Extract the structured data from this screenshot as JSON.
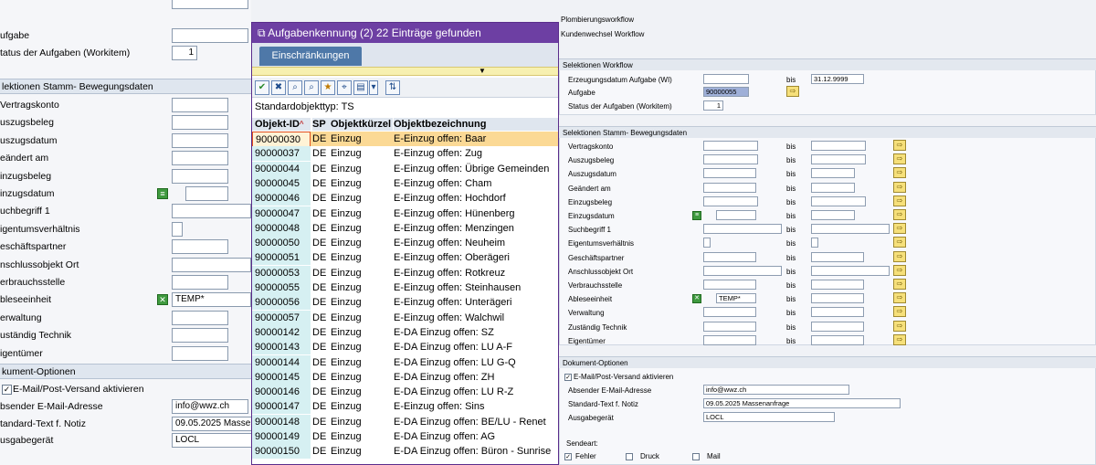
{
  "left": {
    "rows_top": [
      {
        "label": "ufgabe"
      },
      {
        "label": "tatus der Aufgaben (Workitem)",
        "value": "1"
      }
    ],
    "section_stamm": "lektionen Stamm- Bewegungsdaten",
    "stamm_rows": [
      {
        "label": "Vertragskonto"
      },
      {
        "label": "uszugsbeleg"
      },
      {
        "label": "uszugsdatum"
      },
      {
        "label": "eändert am"
      },
      {
        "label": "inzugsbeleg"
      },
      {
        "label": "inzugsdatum"
      },
      {
        "label": "uchbegriff 1"
      },
      {
        "label": "igentumsverhältnis"
      },
      {
        "label": "eschäftspartner"
      },
      {
        "label": "nschlussobjekt Ort"
      },
      {
        "label": "erbrauchsstelle"
      },
      {
        "label": "bleseeinheit",
        "value": "TEMP*"
      },
      {
        "label": "erwaltung"
      },
      {
        "label": "uständig Technik"
      },
      {
        "label": "igentümer"
      }
    ],
    "section_dok": "kument-Optionen",
    "dok_check": "E-Mail/Post-Versand aktivieren",
    "dok_rows": [
      {
        "label": "bsender E-Mail-Adresse",
        "value": "info@wwz.ch"
      },
      {
        "label": "tandard-Text f. Notiz",
        "value": "09.05.2025 Masse"
      },
      {
        "label": "usgabegerät",
        "value": "LOCL"
      }
    ]
  },
  "dialog": {
    "title": "Aufgabenkennung (2)   22 Einträge gefunden",
    "tab": "Einschränkungen",
    "objtype": "Standardobjekttyp: TS",
    "columns": {
      "id": "Objekt-ID",
      "sp": "SP",
      "kurz": "Objektkürzel",
      "bez": "Objektbezeichnung"
    },
    "rows": [
      {
        "id": "90000030",
        "sp": "DE",
        "kurz": "Einzug",
        "bez": "E-Einzug offen: Baar"
      },
      {
        "id": "90000037",
        "sp": "DE",
        "kurz": "Einzug",
        "bez": "E-Einzug offen: Zug"
      },
      {
        "id": "90000044",
        "sp": "DE",
        "kurz": "Einzug",
        "bez": "E-Einzug offen: Übrige Gemeinden"
      },
      {
        "id": "90000045",
        "sp": "DE",
        "kurz": "Einzug",
        "bez": "E-Einzug offen: Cham"
      },
      {
        "id": "90000046",
        "sp": "DE",
        "kurz": "Einzug",
        "bez": "E-Einzug offen: Hochdorf"
      },
      {
        "id": "90000047",
        "sp": "DE",
        "kurz": "Einzug",
        "bez": "E-Einzug offen: Hünenberg"
      },
      {
        "id": "90000048",
        "sp": "DE",
        "kurz": "Einzug",
        "bez": "E-Einzug offen: Menzingen"
      },
      {
        "id": "90000050",
        "sp": "DE",
        "kurz": "Einzug",
        "bez": "E-Einzug offen: Neuheim"
      },
      {
        "id": "90000051",
        "sp": "DE",
        "kurz": "Einzug",
        "bez": "E-Einzug offen: Oberägeri"
      },
      {
        "id": "90000053",
        "sp": "DE",
        "kurz": "Einzug",
        "bez": "E-Einzug offen: Rotkreuz"
      },
      {
        "id": "90000055",
        "sp": "DE",
        "kurz": "Einzug",
        "bez": "E-Einzug offen: Steinhausen"
      },
      {
        "id": "90000056",
        "sp": "DE",
        "kurz": "Einzug",
        "bez": "E-Einzug offen: Unterägeri"
      },
      {
        "id": "90000057",
        "sp": "DE",
        "kurz": "Einzug",
        "bez": "E-Einzug offen: Walchwil"
      },
      {
        "id": "90000142",
        "sp": "DE",
        "kurz": "Einzug",
        "bez": "E-DA Einzug offen: SZ"
      },
      {
        "id": "90000143",
        "sp": "DE",
        "kurz": "Einzug",
        "bez": "E-DA Einzug offen: LU A-F"
      },
      {
        "id": "90000144",
        "sp": "DE",
        "kurz": "Einzug",
        "bez": "E-DA Einzug offen: LU G-Q"
      },
      {
        "id": "90000145",
        "sp": "DE",
        "kurz": "Einzug",
        "bez": "E-DA Einzug offen: ZH"
      },
      {
        "id": "90000146",
        "sp": "DE",
        "kurz": "Einzug",
        "bez": "E-DA Einzug offen: LU R-Z"
      },
      {
        "id": "90000147",
        "sp": "DE",
        "kurz": "Einzug",
        "bez": "E-Einzug offen: Sins"
      },
      {
        "id": "90000148",
        "sp": "DE",
        "kurz": "Einzug",
        "bez": "E-DA Einzug offen: BE/LU - Renet"
      },
      {
        "id": "90000149",
        "sp": "DE",
        "kurz": "Einzug",
        "bez": "E-DA Einzug offen: AG"
      },
      {
        "id": "90000150",
        "sp": "DE",
        "kurz": "Einzug",
        "bez": "E-DA Einzug offen: Büron - Sunrise"
      }
    ]
  },
  "right": {
    "radio1": "Plombierungsworkflow",
    "radio2": "Kundenwechsel Workflow",
    "section_wf": "Selektionen Workflow",
    "wf_rows": [
      {
        "label": "Erzeugungsdatum Aufgabe (WI)",
        "bis": "bis",
        "to": "31.12.9999"
      },
      {
        "label": "Aufgabe",
        "value": "90000055"
      },
      {
        "label": "Status der Aufgaben (Workitem)",
        "value": "1"
      }
    ],
    "section_stamm": "Selektionen Stamm- Bewegungsdaten",
    "stamm_rows": [
      {
        "label": "Vertragskonto"
      },
      {
        "label": "Auszugsbeleg"
      },
      {
        "label": "Auszugsdatum"
      },
      {
        "label": "Geändert am"
      },
      {
        "label": "Einzugsbeleg"
      },
      {
        "label": "Einzugsdatum"
      },
      {
        "label": "Suchbegriff 1"
      },
      {
        "label": "Eigentumsverhältnis"
      },
      {
        "label": "Geschäftspartner"
      },
      {
        "label": "Anschlussobjekt Ort"
      },
      {
        "label": "Verbrauchsstelle"
      },
      {
        "label": "Ableseeinheit",
        "value": "TEMP*"
      },
      {
        "label": "Verwaltung"
      },
      {
        "label": "Zuständig Technik"
      },
      {
        "label": "Eigentümer"
      }
    ],
    "bis": "bis",
    "section_dok": "Dokument-Optionen",
    "dok_check": "E-Mail/Post-Versand aktivieren",
    "dok_rows": [
      {
        "label": "Absender E-Mail-Adresse",
        "value": "info@wwz.ch"
      },
      {
        "label": "Standard-Text f. Notiz",
        "value": "09.05.2025 Massenanfrage"
      },
      {
        "label": "Ausgabegerät",
        "value": "LOCL"
      }
    ],
    "sendeart": "Sendeart:",
    "send_opts": [
      {
        "label": "Fehler",
        "checked": "✓"
      },
      {
        "label": "Druck",
        "checked": ""
      },
      {
        "label": "Mail",
        "checked": ""
      }
    ]
  }
}
